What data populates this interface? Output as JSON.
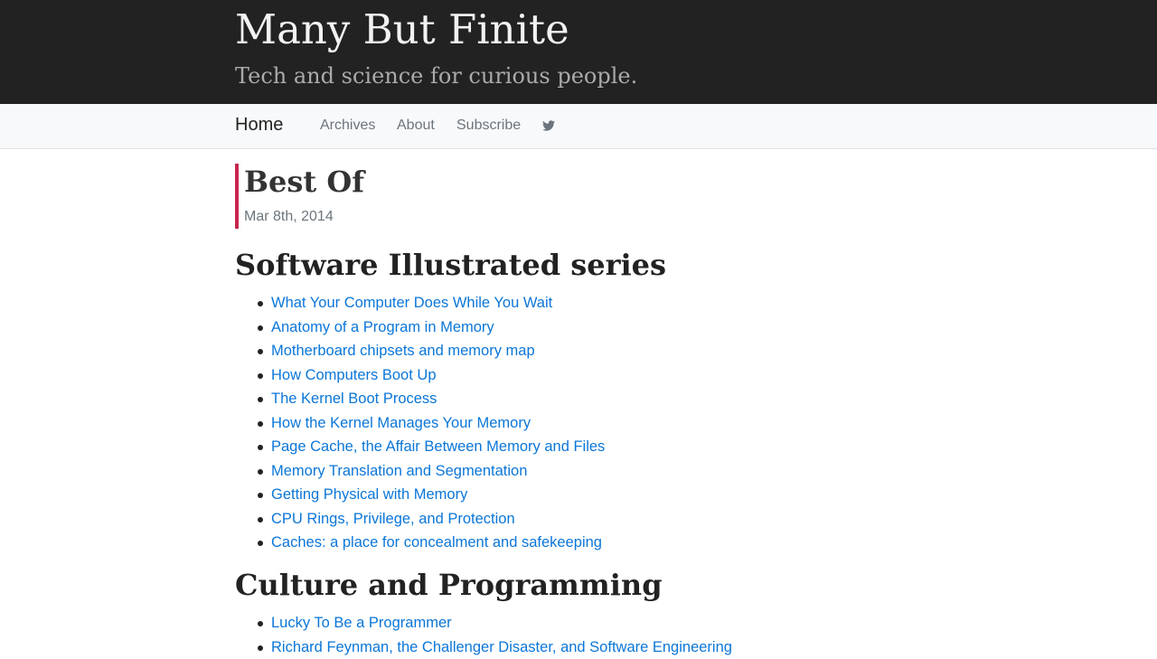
{
  "header": {
    "title": "Many But Finite",
    "tagline": "Tech and science for curious people."
  },
  "nav": {
    "home": "Home",
    "archives": "Archives",
    "about": "About",
    "subscribe": "Subscribe",
    "twitter_icon": "twitter-bird-icon"
  },
  "post": {
    "title": "Best Of",
    "date": "Mar 8th, 2014",
    "accent_color": "#c7254e"
  },
  "sections": [
    {
      "heading": "Software Illustrated series",
      "items": [
        "What Your Computer Does While You Wait",
        "Anatomy of a Program in Memory",
        "Motherboard chipsets and memory map",
        "How Computers Boot Up",
        "The Kernel Boot Process",
        "How the Kernel Manages Your Memory",
        "Page Cache, the Affair Between Memory and Files",
        "Memory Translation and Segmentation",
        "Getting Physical with Memory",
        "CPU Rings, Privilege, and Protection",
        "Caches: a place for concealment and safekeeping"
      ]
    },
    {
      "heading": "Culture and Programming",
      "items": [
        "Lucky To Be a Programmer",
        "Richard Feynman, the Challenger Disaster, and Software Engineering"
      ]
    }
  ],
  "colors": {
    "header_bg": "#222222",
    "link": "#0b76d8",
    "nav_bg": "#f8f9fa"
  }
}
